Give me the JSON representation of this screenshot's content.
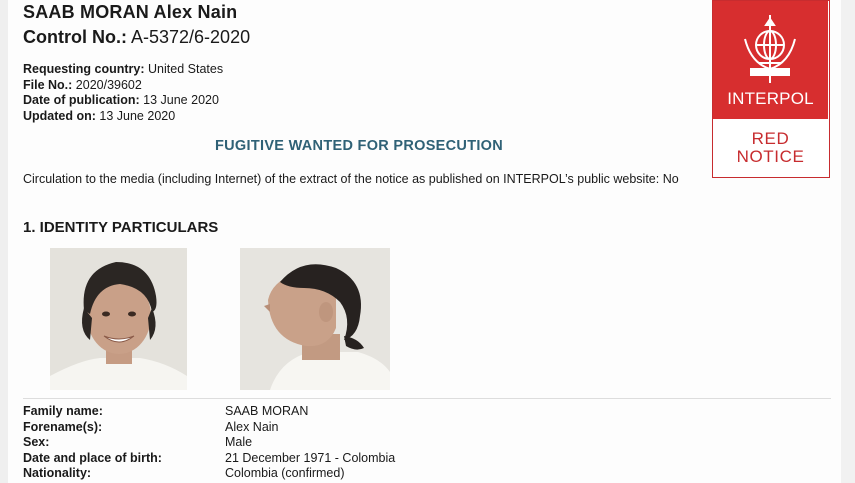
{
  "header": {
    "name": "SAAB MORAN Alex Nain",
    "control_label": "Control No.:",
    "control_value": "A-5372/6-2020"
  },
  "meta": {
    "requesting_country_label": "Requesting country:",
    "requesting_country_value": "United States",
    "file_no_label": "File No.:",
    "file_no_value": "2020/39602",
    "publication_label": "Date of publication:",
    "publication_value": "13 June 2020",
    "updated_label": "Updated on:",
    "updated_value": "13 June 2020"
  },
  "notice_type": "FUGITIVE WANTED FOR PROSECUTION",
  "circulation_text": "Circulation to the media (including Internet) of the extract of the notice as published on INTERPOL’s public website: No",
  "section": {
    "title": "1. IDENTITY PARTICULARS"
  },
  "logo": {
    "wordmark": "INTERPOL",
    "red_line1": "RED",
    "red_line2": "NOTICE",
    "color": "#d72e2f"
  },
  "particulars": [
    {
      "label": "Family name:",
      "value": "SAAB MORAN"
    },
    {
      "label": "Forename(s):",
      "value": "Alex Nain"
    },
    {
      "label": "Sex:",
      "value": "Male"
    },
    {
      "label": "Date and place of birth:",
      "value": "21 December 1971 - Colombia"
    },
    {
      "label": "Nationality:",
      "value": "Colombia (confirmed)"
    }
  ],
  "photos": [
    {
      "name": "frontal-photo",
      "icon": "portrait-front"
    },
    {
      "name": "profile-photo",
      "icon": "portrait-profile"
    }
  ]
}
